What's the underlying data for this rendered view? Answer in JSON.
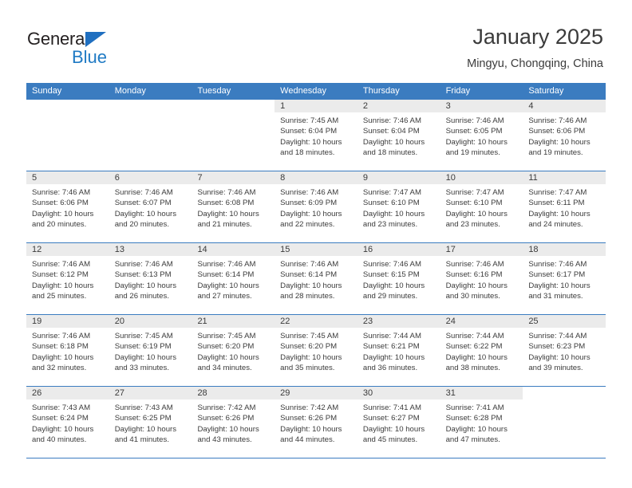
{
  "brand": {
    "line1": "General",
    "line2": "Blue",
    "triangle_icon": "brand-triangle-icon",
    "accent_color": "#1f7ac4"
  },
  "header": {
    "title": "January 2025",
    "location": "Mingyu, Chongqing, China"
  },
  "calendar": {
    "header_bg": "#3b7cc0",
    "daynum_band_bg": "#ebebeb",
    "weekdays": [
      "Sunday",
      "Monday",
      "Tuesday",
      "Wednesday",
      "Thursday",
      "Friday",
      "Saturday"
    ],
    "weeks": [
      [
        {
          "empty": true
        },
        {
          "empty": true
        },
        {
          "empty": true
        },
        {
          "day": "1",
          "sunrise": "Sunrise: 7:45 AM",
          "sunset": "Sunset: 6:04 PM",
          "daylight1": "Daylight: 10 hours",
          "daylight2": "and 18 minutes."
        },
        {
          "day": "2",
          "sunrise": "Sunrise: 7:46 AM",
          "sunset": "Sunset: 6:04 PM",
          "daylight1": "Daylight: 10 hours",
          "daylight2": "and 18 minutes."
        },
        {
          "day": "3",
          "sunrise": "Sunrise: 7:46 AM",
          "sunset": "Sunset: 6:05 PM",
          "daylight1": "Daylight: 10 hours",
          "daylight2": "and 19 minutes."
        },
        {
          "day": "4",
          "sunrise": "Sunrise: 7:46 AM",
          "sunset": "Sunset: 6:06 PM",
          "daylight1": "Daylight: 10 hours",
          "daylight2": "and 19 minutes."
        }
      ],
      [
        {
          "day": "5",
          "sunrise": "Sunrise: 7:46 AM",
          "sunset": "Sunset: 6:06 PM",
          "daylight1": "Daylight: 10 hours",
          "daylight2": "and 20 minutes."
        },
        {
          "day": "6",
          "sunrise": "Sunrise: 7:46 AM",
          "sunset": "Sunset: 6:07 PM",
          "daylight1": "Daylight: 10 hours",
          "daylight2": "and 20 minutes."
        },
        {
          "day": "7",
          "sunrise": "Sunrise: 7:46 AM",
          "sunset": "Sunset: 6:08 PM",
          "daylight1": "Daylight: 10 hours",
          "daylight2": "and 21 minutes."
        },
        {
          "day": "8",
          "sunrise": "Sunrise: 7:46 AM",
          "sunset": "Sunset: 6:09 PM",
          "daylight1": "Daylight: 10 hours",
          "daylight2": "and 22 minutes."
        },
        {
          "day": "9",
          "sunrise": "Sunrise: 7:47 AM",
          "sunset": "Sunset: 6:10 PM",
          "daylight1": "Daylight: 10 hours",
          "daylight2": "and 23 minutes."
        },
        {
          "day": "10",
          "sunrise": "Sunrise: 7:47 AM",
          "sunset": "Sunset: 6:10 PM",
          "daylight1": "Daylight: 10 hours",
          "daylight2": "and 23 minutes."
        },
        {
          "day": "11",
          "sunrise": "Sunrise: 7:47 AM",
          "sunset": "Sunset: 6:11 PM",
          "daylight1": "Daylight: 10 hours",
          "daylight2": "and 24 minutes."
        }
      ],
      [
        {
          "day": "12",
          "sunrise": "Sunrise: 7:46 AM",
          "sunset": "Sunset: 6:12 PM",
          "daylight1": "Daylight: 10 hours",
          "daylight2": "and 25 minutes."
        },
        {
          "day": "13",
          "sunrise": "Sunrise: 7:46 AM",
          "sunset": "Sunset: 6:13 PM",
          "daylight1": "Daylight: 10 hours",
          "daylight2": "and 26 minutes."
        },
        {
          "day": "14",
          "sunrise": "Sunrise: 7:46 AM",
          "sunset": "Sunset: 6:14 PM",
          "daylight1": "Daylight: 10 hours",
          "daylight2": "and 27 minutes."
        },
        {
          "day": "15",
          "sunrise": "Sunrise: 7:46 AM",
          "sunset": "Sunset: 6:14 PM",
          "daylight1": "Daylight: 10 hours",
          "daylight2": "and 28 minutes."
        },
        {
          "day": "16",
          "sunrise": "Sunrise: 7:46 AM",
          "sunset": "Sunset: 6:15 PM",
          "daylight1": "Daylight: 10 hours",
          "daylight2": "and 29 minutes."
        },
        {
          "day": "17",
          "sunrise": "Sunrise: 7:46 AM",
          "sunset": "Sunset: 6:16 PM",
          "daylight1": "Daylight: 10 hours",
          "daylight2": "and 30 minutes."
        },
        {
          "day": "18",
          "sunrise": "Sunrise: 7:46 AM",
          "sunset": "Sunset: 6:17 PM",
          "daylight1": "Daylight: 10 hours",
          "daylight2": "and 31 minutes."
        }
      ],
      [
        {
          "day": "19",
          "sunrise": "Sunrise: 7:46 AM",
          "sunset": "Sunset: 6:18 PM",
          "daylight1": "Daylight: 10 hours",
          "daylight2": "and 32 minutes."
        },
        {
          "day": "20",
          "sunrise": "Sunrise: 7:45 AM",
          "sunset": "Sunset: 6:19 PM",
          "daylight1": "Daylight: 10 hours",
          "daylight2": "and 33 minutes."
        },
        {
          "day": "21",
          "sunrise": "Sunrise: 7:45 AM",
          "sunset": "Sunset: 6:20 PM",
          "daylight1": "Daylight: 10 hours",
          "daylight2": "and 34 minutes."
        },
        {
          "day": "22",
          "sunrise": "Sunrise: 7:45 AM",
          "sunset": "Sunset: 6:20 PM",
          "daylight1": "Daylight: 10 hours",
          "daylight2": "and 35 minutes."
        },
        {
          "day": "23",
          "sunrise": "Sunrise: 7:44 AM",
          "sunset": "Sunset: 6:21 PM",
          "daylight1": "Daylight: 10 hours",
          "daylight2": "and 36 minutes."
        },
        {
          "day": "24",
          "sunrise": "Sunrise: 7:44 AM",
          "sunset": "Sunset: 6:22 PM",
          "daylight1": "Daylight: 10 hours",
          "daylight2": "and 38 minutes."
        },
        {
          "day": "25",
          "sunrise": "Sunrise: 7:44 AM",
          "sunset": "Sunset: 6:23 PM",
          "daylight1": "Daylight: 10 hours",
          "daylight2": "and 39 minutes."
        }
      ],
      [
        {
          "day": "26",
          "sunrise": "Sunrise: 7:43 AM",
          "sunset": "Sunset: 6:24 PM",
          "daylight1": "Daylight: 10 hours",
          "daylight2": "and 40 minutes."
        },
        {
          "day": "27",
          "sunrise": "Sunrise: 7:43 AM",
          "sunset": "Sunset: 6:25 PM",
          "daylight1": "Daylight: 10 hours",
          "daylight2": "and 41 minutes."
        },
        {
          "day": "28",
          "sunrise": "Sunrise: 7:42 AM",
          "sunset": "Sunset: 6:26 PM",
          "daylight1": "Daylight: 10 hours",
          "daylight2": "and 43 minutes."
        },
        {
          "day": "29",
          "sunrise": "Sunrise: 7:42 AM",
          "sunset": "Sunset: 6:26 PM",
          "daylight1": "Daylight: 10 hours",
          "daylight2": "and 44 minutes."
        },
        {
          "day": "30",
          "sunrise": "Sunrise: 7:41 AM",
          "sunset": "Sunset: 6:27 PM",
          "daylight1": "Daylight: 10 hours",
          "daylight2": "and 45 minutes."
        },
        {
          "day": "31",
          "sunrise": "Sunrise: 7:41 AM",
          "sunset": "Sunset: 6:28 PM",
          "daylight1": "Daylight: 10 hours",
          "daylight2": "and 47 minutes."
        },
        {
          "empty": true
        }
      ]
    ]
  }
}
